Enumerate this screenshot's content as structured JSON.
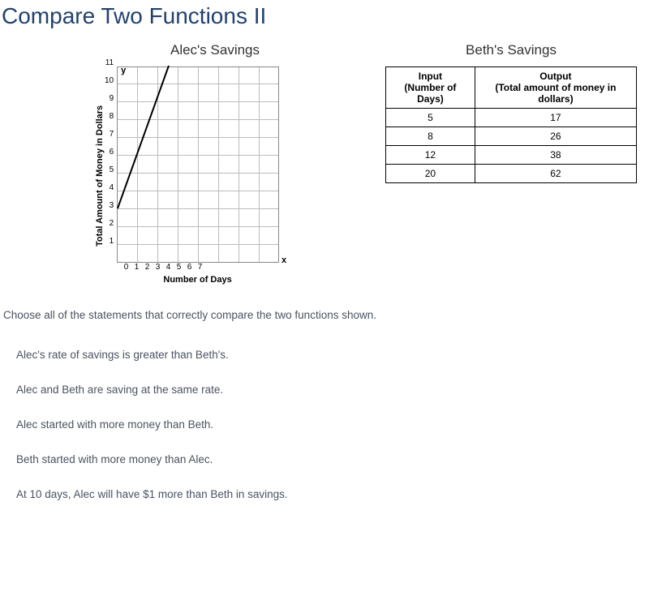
{
  "title": "Compare Two Functions II",
  "left_heading": "Alec's Savings",
  "right_heading": "Beth's Savings",
  "chart_data": {
    "type": "line",
    "xlabel": "Number of Days",
    "ylabel": "Total Amount of Money in Dollars",
    "x_axis_letter": "x",
    "y_axis_letter": "y",
    "xlim": [
      0,
      7
    ],
    "ylim": [
      0,
      11
    ],
    "xticks": [
      0,
      1,
      2,
      3,
      4,
      5,
      6,
      7
    ],
    "yticks": [
      1,
      2,
      3,
      4,
      5,
      6,
      7,
      8,
      9,
      10,
      11
    ],
    "series": [
      {
        "name": "Alec",
        "points": [
          [
            0,
            3
          ],
          [
            2.5,
            11
          ]
        ]
      }
    ]
  },
  "table": {
    "headers": [
      "Input\n(Number of Days)",
      "Output\n(Total amount of money in dollars)"
    ],
    "rows": [
      [
        "5",
        "17"
      ],
      [
        "8",
        "26"
      ],
      [
        "12",
        "38"
      ],
      [
        "20",
        "62"
      ]
    ]
  },
  "question": "Choose all of the statements that correctly compare the two functions shown.",
  "answers": [
    "Alec's rate of savings is greater than Beth's.",
    "Alec and Beth are saving at the same rate.",
    "Alec started with more money than Beth.",
    "Beth started with more money than Alec.",
    "At 10 days, Alec will have $1 more than Beth in savings."
  ]
}
